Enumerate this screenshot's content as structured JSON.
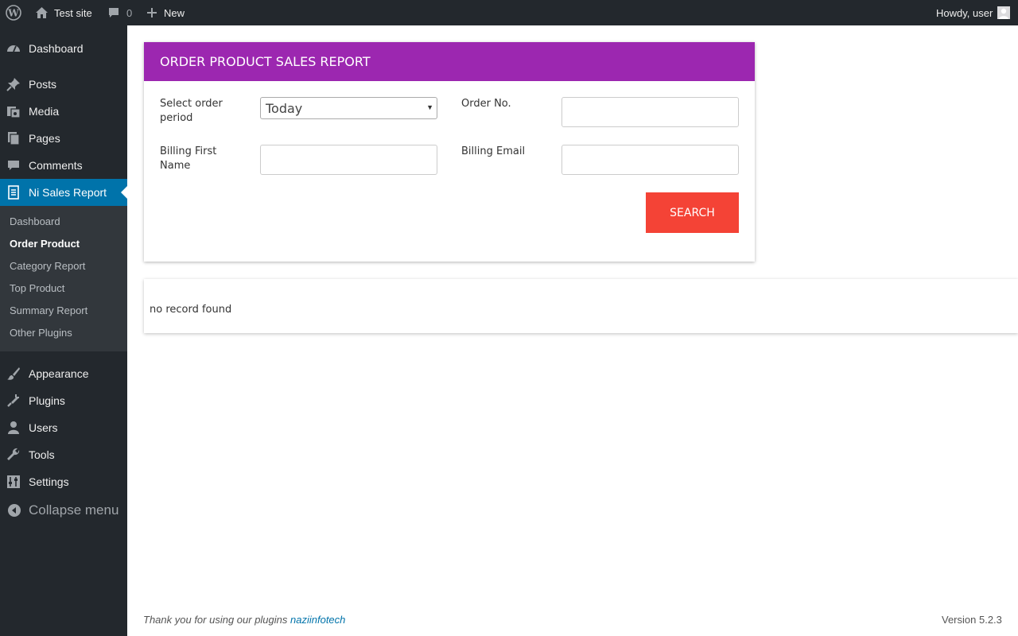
{
  "adminbar": {
    "site_name": "Test site",
    "comments_count": "0",
    "new_label": "New",
    "greeting": "Howdy, user",
    "icons": [
      "wordpress-logo-icon",
      "home-icon",
      "comment-icon",
      "plus-icon",
      "avatar"
    ]
  },
  "sidebar": {
    "items": [
      {
        "label": "Dashboard",
        "icon": "dashboard-icon"
      },
      {
        "label": "Posts",
        "icon": "pin-icon"
      },
      {
        "label": "Media",
        "icon": "media-icon"
      },
      {
        "label": "Pages",
        "icon": "pages-icon"
      },
      {
        "label": "Comments",
        "icon": "comment-icon"
      },
      {
        "label": "Ni Sales Report",
        "icon": "report-icon",
        "active": true
      },
      {
        "label": "Appearance",
        "icon": "brush-icon"
      },
      {
        "label": "Plugins",
        "icon": "plug-icon"
      },
      {
        "label": "Users",
        "icon": "user-icon"
      },
      {
        "label": "Tools",
        "icon": "wrench-icon"
      },
      {
        "label": "Settings",
        "icon": "sliders-icon"
      }
    ],
    "submenu": [
      {
        "label": "Dashboard"
      },
      {
        "label": "Order Product",
        "current": true
      },
      {
        "label": "Category Report"
      },
      {
        "label": "Top Product"
      },
      {
        "label": "Summary Report"
      },
      {
        "label": "Other Plugins"
      }
    ],
    "collapse_label": "Collapse menu"
  },
  "report": {
    "title": "ORDER PRODUCT SALES REPORT",
    "period_label": "Select order period",
    "period_value": "Today",
    "order_no_label": "Order No.",
    "order_no_value": "",
    "billing_first_name_label": "Billing First Name",
    "billing_first_name_value": "",
    "billing_email_label": "Billing Email",
    "billing_email_value": "",
    "search_label": "SEARCH",
    "header_color": "#9c27b0",
    "button_color": "#f44336"
  },
  "results": {
    "message": "no record found"
  },
  "footer": {
    "thanks_text": "Thank you for using our plugins",
    "link_text": "naziinfotech",
    "version": "Version 5.2.3"
  }
}
